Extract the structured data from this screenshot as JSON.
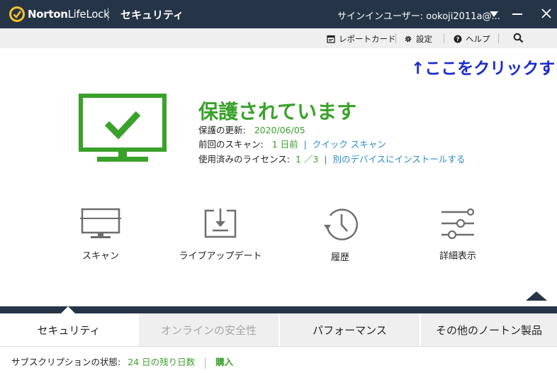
{
  "titlebar": {
    "logo_norton": "Norton",
    "logo_lifelock": "LifeLock",
    "app_title": "セキュリティ",
    "signin_label": "サインインユーザー: ookoji2011a@..."
  },
  "toolbar": {
    "report_card": "レポートカード",
    "settings": "設定",
    "help": "ヘルプ"
  },
  "annotation": "↑ここをクリックする",
  "status": {
    "title": "保護されています",
    "update_label": "保護の更新:",
    "update_value": "2020/06/05",
    "scan_label": "前回のスキャン:",
    "scan_value": "1 日前",
    "scan_link": "クイック スキャン",
    "license_label": "使用済みのライセンス:",
    "license_value": "1 ／3",
    "license_link": "別のデバイスにインストールする"
  },
  "actions": [
    {
      "label": "スキャン",
      "icon": "monitor-scan-icon"
    },
    {
      "label": "ライブアップデート",
      "icon": "download-tray-icon"
    },
    {
      "label": "履歴",
      "icon": "history-clock-icon"
    },
    {
      "label": "詳細表示",
      "icon": "sliders-icon"
    }
  ],
  "tabs": [
    {
      "label": "セキュリティ",
      "state": "active"
    },
    {
      "label": "オンラインの安全性",
      "state": "disabled"
    },
    {
      "label": "パフォーマンス",
      "state": "normal"
    },
    {
      "label": "その他のノートン製品",
      "state": "normal"
    }
  ],
  "footer": {
    "subscription_label": "サブスクリプションの状態:",
    "days_left": "24 日の残り日数",
    "buy": "購入"
  },
  "colors": {
    "header": "#253447",
    "protected_green": "#3aa12a",
    "link_blue": "#2b8ad0",
    "annotation_blue": "#1a2bcc"
  }
}
